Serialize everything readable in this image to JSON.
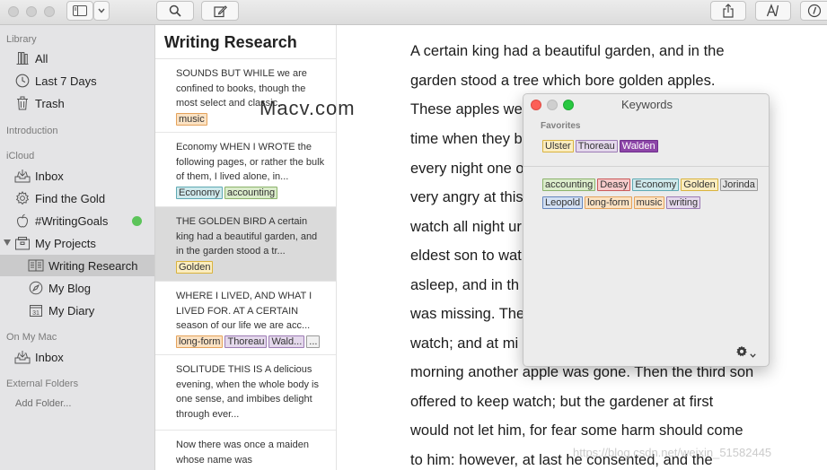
{
  "toolbar": {
    "buttons": [
      "sidebar-toggle",
      "chevron-down",
      "search",
      "compose",
      "share",
      "typography",
      "info"
    ]
  },
  "sidebar": {
    "sections": {
      "library": "Library",
      "introduction": "Introduction",
      "icloud": "iCloud",
      "on_my_mac": "On My Mac",
      "external": "External Folders"
    },
    "library_items": [
      {
        "label": "All",
        "icon": "library-icon"
      },
      {
        "label": "Last 7 Days",
        "icon": "clock-icon"
      },
      {
        "label": "Trash",
        "icon": "trash-icon"
      }
    ],
    "icloud_items": [
      {
        "label": "Inbox",
        "icon": "inbox-icon"
      },
      {
        "label": "Find the Gold",
        "icon": "gear-icon"
      },
      {
        "label": "#WritingGoals",
        "icon": "apple-icon"
      },
      {
        "label": "My Projects",
        "icon": "projects-icon"
      },
      {
        "label": "Writing Research",
        "icon": "book-icon"
      },
      {
        "label": "My Blog",
        "icon": "compass-icon"
      },
      {
        "label": "My Diary",
        "icon": "calendar-icon"
      }
    ],
    "calendar_day": "31",
    "mac_items": [
      {
        "label": "Inbox",
        "icon": "inbox-icon"
      }
    ],
    "add_folder": "Add Folder..."
  },
  "sheet_list": {
    "title": "Writing Research",
    "sheets": [
      {
        "text": "SOUNDS BUT WHILE we are confined to books, though the most select and classic...",
        "keywords": [
          {
            "label": "music",
            "color": "orange"
          }
        ]
      },
      {
        "text": "Economy WHEN I WROTE the following pages, or rather the bulk of them, I lived alone, in...",
        "keywords": [
          {
            "label": "Economy",
            "color": "teal"
          },
          {
            "label": "accounting",
            "color": "green"
          }
        ]
      },
      {
        "text": "THE GOLDEN BIRD A certain king had a beautiful garden, and in the garden stood a tr...",
        "keywords": [
          {
            "label": "Golden",
            "color": "yellow"
          }
        ]
      },
      {
        "text": "WHERE I LIVED, AND WHAT I LIVED FOR. AT A CERTAIN season of our life we are acc...",
        "keywords": [
          {
            "label": "long-form",
            "color": "orange"
          },
          {
            "label": "Thoreau",
            "color": "purple"
          },
          {
            "label": "Wald...",
            "color": "purple"
          },
          {
            "label": "...",
            "color": "more"
          }
        ]
      },
      {
        "text": "SOLITUDE THIS IS A delicious evening, when the whole body is one sense, and imbibes delight through ever...",
        "keywords": []
      },
      {
        "text": "Now there was once a maiden whose name was",
        "keywords": []
      }
    ]
  },
  "editor": {
    "lines": [
      "A certain king had a beautiful garden, and in the",
      "garden stood a tree which bore golden apples.",
      "These apples we",
      "time when they b",
      "every night one o",
      "very angry at this",
      "watch all night ur",
      "eldest son to wat",
      "asleep, and in th",
      "was missing. The",
      "watch; and at mi",
      "morning another apple was gone. Then the third son",
      "offered to keep watch; but the gardener at first",
      "would not let him, for fear some harm should come",
      "to him: however, at last he consented, and the"
    ]
  },
  "keywords_panel": {
    "title": "Keywords",
    "favorites_label": "Favorites",
    "favorites": [
      {
        "label": "Ulster",
        "color": "yellow"
      },
      {
        "label": "Thoreau",
        "color": "purple"
      },
      {
        "label": "Walden",
        "color": "purple-solid"
      }
    ],
    "all": [
      {
        "label": "accounting",
        "color": "green"
      },
      {
        "label": "Deasy",
        "color": "red"
      },
      {
        "label": "Economy",
        "color": "teal"
      },
      {
        "label": "Golden",
        "color": "yellow"
      },
      {
        "label": "Jorinda",
        "color": "gray"
      },
      {
        "label": "Leopold",
        "color": "blue"
      },
      {
        "label": "long-form",
        "color": "orange"
      },
      {
        "label": "music",
        "color": "orange"
      },
      {
        "label": "writing",
        "color": "purple"
      }
    ]
  },
  "watermarks": {
    "macv": "Macv.com",
    "csdn": "https://blog.csdn.net/weixin_51582445"
  },
  "colors": {
    "sidebar_bg": "#e4e4e6",
    "selection": "#cacacb",
    "green_status": "#5cc45a",
    "close_red": "#fc5f57",
    "minimize_yellow": "#fdbc2e",
    "zoom_green": "#28c840"
  }
}
